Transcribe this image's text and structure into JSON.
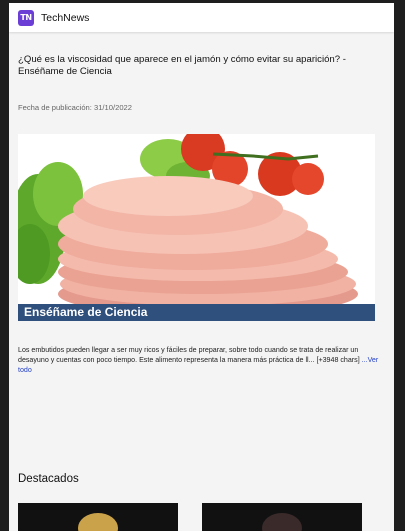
{
  "app": {
    "name": "TechNews",
    "logo_text": "TN",
    "accent": "#6b3fd6"
  },
  "article": {
    "title": "¿Qué es la viscosidad que aparece en el jamón y cómo evitar su aparición? - Enséñame de Ciencia",
    "date": "Fecha de publicación: 31/10/2022",
    "image_banner": "Enséñame de Ciencia",
    "excerpt": "Los embutidos pueden llegar a ser muy ricos y fáciles de preparar, sobre todo cuando se trata de realizar un desayuno y cuentas con poco tiempo. Este alimento representa la manera más práctica de ll... [+3948 chars] ",
    "more_link": "...Ver todo"
  },
  "featured": {
    "title": "Destacados"
  },
  "colors": {
    "banner": "#2f4f7c",
    "link": "#2340c8"
  }
}
